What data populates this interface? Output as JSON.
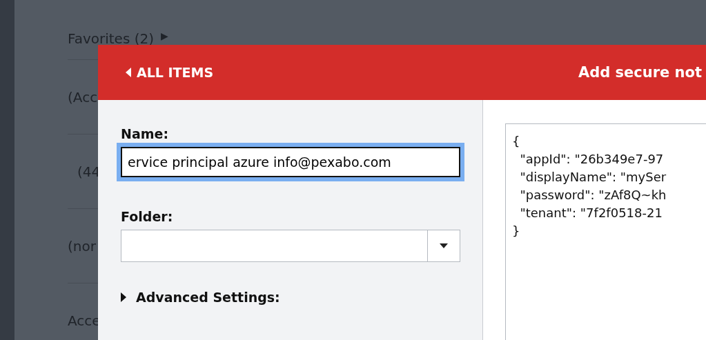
{
  "background_list": [
    {
      "label": "Favorites (2)",
      "arrow": "▶"
    },
    {
      "label": "(Acc"
    },
    {
      "label": "(44"
    },
    {
      "label": "(nor"
    },
    {
      "label": "Acce"
    }
  ],
  "dialog": {
    "back_button": "ALL ITEMS",
    "title": "Add secure not",
    "name": {
      "label": "Name:",
      "value": "ervice principal azure info@pexabo.com",
      "focused": true
    },
    "folder": {
      "label": "Folder:"
    },
    "advanced": {
      "label": "Advanced Settings:",
      "expanded": false
    },
    "notes": [
      "{",
      "  \"appId\": \"26b349e7-97",
      "  \"displayName\": \"mySer",
      "  \"password\": \"zAf8Q~kh",
      "  \"tenant\": \"7f2f0518-21",
      "}"
    ]
  }
}
